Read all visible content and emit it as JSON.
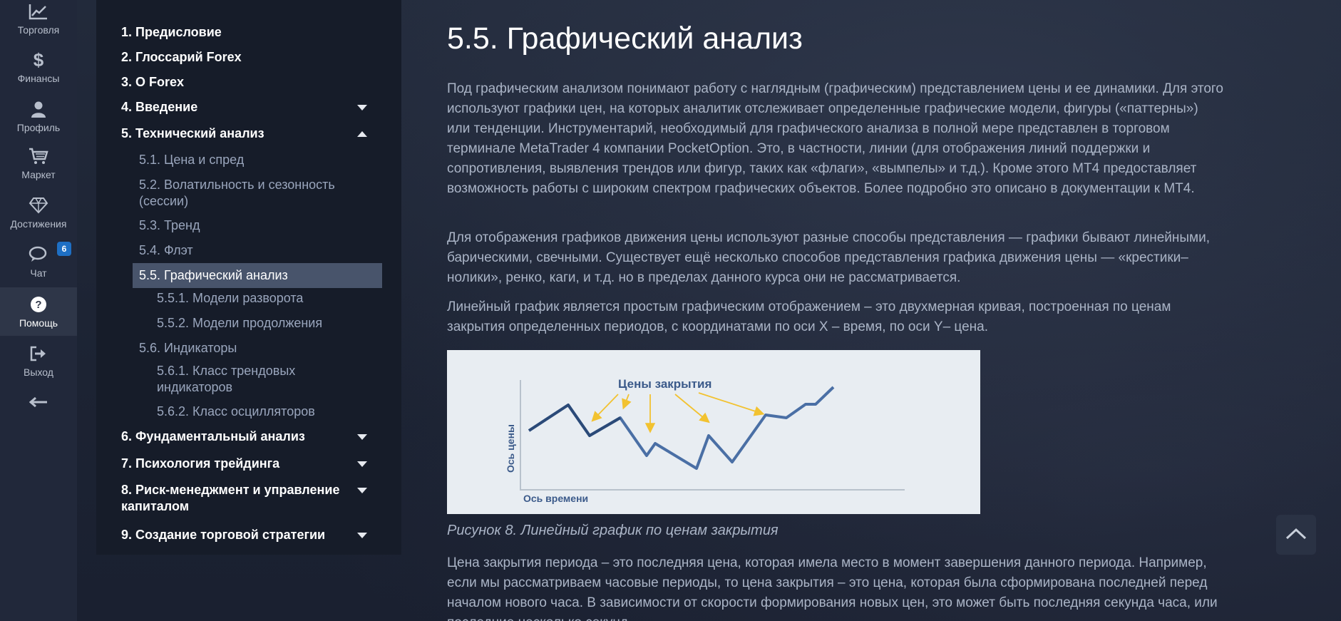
{
  "rail": {
    "items": [
      {
        "label": "Торговля",
        "icon": "chart-line-icon"
      },
      {
        "label": "Финансы",
        "icon": "dollar-icon"
      },
      {
        "label": "Профиль",
        "icon": "user-icon"
      },
      {
        "label": "Маркет",
        "icon": "cart-icon"
      },
      {
        "label": "Достижения",
        "icon": "diamond-icon"
      },
      {
        "label": "Чат",
        "icon": "chat-icon",
        "badge": "6"
      },
      {
        "label": "Помощь",
        "icon": "help-icon"
      },
      {
        "label": "Выход",
        "icon": "logout-icon"
      }
    ]
  },
  "toc": {
    "items": [
      "1. Предисловие",
      "2. Глоссарий Forex",
      "3. О Forex",
      "4. Введение",
      "5. Технический анализ",
      "5.1. Цена и спред",
      "5.2. Волатильность и сезонность (сессии)",
      "5.3. Тренд",
      "5.4. Флэт",
      "5.5. Графический анализ",
      "5.5.1. Модели разворота",
      "5.5.2. Модели продолжения",
      "5.6. Индикаторы",
      "5.6.1. Класс трендовых индикаторов",
      "5.6.2. Класс осцилляторов",
      "6. Фундаментальный анализ",
      "7. Психология трейдинга",
      "8. Риск-менеджмент и управление капиталом",
      "9. Создание торговой стратегии"
    ]
  },
  "content": {
    "title": "5.5. Графический анализ",
    "paragraphs": [
      "Под графическим анализом понимают работу с наглядным (графическим) представлением цены и ее динамики. Для этого используют графики цен, на которых аналитик отслеживает определенные графические модели, фигуры («паттерны») или тенденции. Инструментарий, необходимый для графического анализа в полной мере представлен в торговом терминале MetaTrader 4 компании PocketOption. Это, в частности, линии (для отображения линий поддержки и сопротивления, выявления трендов или фигур, таких как «флаги», «вымпелы» и т.д.). Кроме этого MT4 предоставляет возможность работы с широким спектром графических объектов. Более подробно это описано в документации к MT4.",
      "Для отображения графиков движения цены используют разные способы представления — графики бывают линейными, барическими, свечными. Существует ещё несколько способов представления графика движения цены — «крестики–нолики», ренко, каги, и т.д. но в пределах данного курса они не рассматривается.",
      "Линейный график является простым графическим отображением – это двухмерная кривая, построенная по ценам закрытия определенных периодов, с координатами по оси X – время, по оси Y– цена.",
      "Цена закрытия периода – это последняя цена, которая имела место в момент завершения данного периода. Например, если мы рассматриваем часовые периоды, то цена закрытия – это цена, которая была сформирована последней перед началом нового часа. В зависимости от скорости формирования новых цен, это может быть последняя секунда часа, или последние несколько секунд."
    ],
    "figure": {
      "label": "Цены закрытия",
      "y_axis": "Ось цены",
      "x_axis": "Ось времени",
      "line_color": "#4a6fa5",
      "arrow_color": "#f2c230"
    },
    "caption": "Рисунок 8. Линейный график по ценам закрытия"
  }
}
